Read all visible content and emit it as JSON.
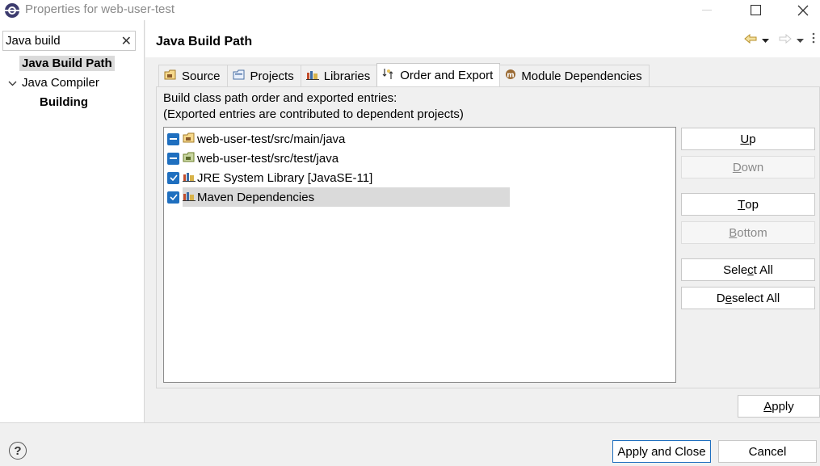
{
  "window": {
    "title": "Properties for web-user-test"
  },
  "filter": {
    "value": "Java build",
    "clear_glyph": "✕"
  },
  "tree": {
    "items": [
      {
        "label": "Java Build Path"
      },
      {
        "label": "Java Compiler"
      },
      {
        "label": "Building"
      }
    ]
  },
  "page": {
    "title": "Java Build Path"
  },
  "tabs": [
    {
      "label": "Source"
    },
    {
      "label": "Projects"
    },
    {
      "label": "Libraries"
    },
    {
      "label": "Order and Export"
    },
    {
      "label": "Module Dependencies"
    }
  ],
  "order_export": {
    "description_line1": "Build class path order and exported entries:",
    "description_line2": "(Exported entries are contributed to dependent projects)",
    "entries": [
      {
        "label": "web-user-test/src/main/java",
        "state": "partial"
      },
      {
        "label": "web-user-test/src/test/java",
        "state": "partial"
      },
      {
        "label": "JRE System Library [JavaSE-11]",
        "state": "checked"
      },
      {
        "label": "Maven Dependencies",
        "state": "checked"
      }
    ]
  },
  "buttons": {
    "up": {
      "pre": "",
      "u": "U",
      "post": "p"
    },
    "down": {
      "pre": "",
      "u": "D",
      "post": "own"
    },
    "top": {
      "pre": "",
      "u": "T",
      "post": "op"
    },
    "bottom": {
      "pre": "",
      "u": "B",
      "post": "ottom"
    },
    "select_all": {
      "pre": "Sele",
      "u": "c",
      "post": "t All"
    },
    "deselect_all": {
      "pre": "D",
      "u": "e",
      "post": "select All"
    },
    "apply": {
      "pre": "",
      "u": "A",
      "post": "pply"
    },
    "apply_and_close": "Apply and Close",
    "cancel": "Cancel"
  },
  "colors": {
    "checkbox_accent": "#1f6fbf",
    "selection": "#dadada"
  }
}
